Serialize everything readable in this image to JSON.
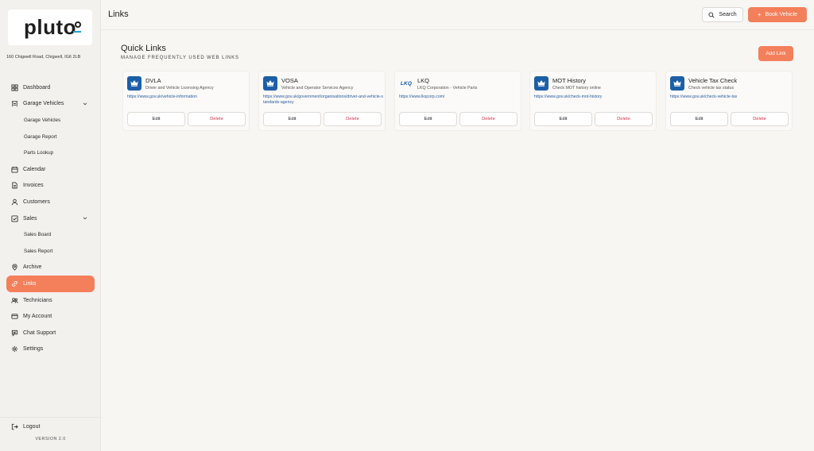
{
  "app": {
    "logo_text": "pluto",
    "address": "160 Chigwell Road, Chigwell, IG6 2LB",
    "version": "VERSION 2.0",
    "accent_color": "#f47f5b",
    "link_color": "#2b5b9e",
    "delete_color": "#d6334a"
  },
  "sidebar": {
    "items": [
      {
        "label": "Dashboard",
        "icon": "dashboard-icon"
      },
      {
        "label": "Garage Vehicles",
        "icon": "garage-icon",
        "expanded": true
      },
      {
        "label": "Garage Vehicles",
        "sub": true
      },
      {
        "label": "Garage Report",
        "sub": true
      },
      {
        "label": "Parts Lookup",
        "sub": true
      },
      {
        "label": "Calendar",
        "icon": "calendar-icon"
      },
      {
        "label": "Invoices",
        "icon": "invoice-icon"
      },
      {
        "label": "Customers",
        "icon": "user-icon"
      },
      {
        "label": "Sales",
        "icon": "sales-icon",
        "expanded": true
      },
      {
        "label": "Sales Board",
        "sub": true
      },
      {
        "label": "Sales Report",
        "sub": true
      },
      {
        "label": "Archive",
        "icon": "archive-icon"
      },
      {
        "label": "Links",
        "icon": "link-icon",
        "active": true
      },
      {
        "label": "Technicians",
        "icon": "technicians-icon"
      },
      {
        "label": "My Account",
        "icon": "account-icon"
      },
      {
        "label": "Chat Support",
        "icon": "chat-icon"
      },
      {
        "label": "Settings",
        "icon": "settings-icon"
      }
    ],
    "logout_label": "Logout"
  },
  "header": {
    "title": "Links",
    "search_label": "Search",
    "book_label": "Book Vehicle"
  },
  "main": {
    "title": "Quick Links",
    "subtitle": "MANAGE FREQUENTLY USED WEB LINKS",
    "add_label": "Add Link",
    "edit_label": "Edit",
    "delete_label": "Delete",
    "links": [
      {
        "name": "DVLA",
        "desc": "Driver and Vehicle Licensing Agency",
        "url": "https://www.gov.uk/vehicle-information",
        "icon": "crown-icon"
      },
      {
        "name": "VOSA",
        "desc": "Vehicle and Operator Services Agency",
        "url": "https://www.gov.uk/government/organisations/driver-and-vehicle-standards-agency",
        "icon": "crown-icon"
      },
      {
        "name": "LKQ",
        "desc": "LKQ Corporation - Vehicle Parts",
        "url": "https://www.lkqcorp.com/",
        "icon": "lkq-logo",
        "logo_text": "LKQ"
      },
      {
        "name": "MOT History",
        "desc": "Check MOT history online",
        "url": "https://www.gov.uk/check-mot-history",
        "icon": "crown-icon"
      },
      {
        "name": "Vehicle Tax Check",
        "desc": "Check vehicle tax status",
        "url": "https://www.gov.uk/check-vehicle-tax",
        "icon": "crown-icon"
      }
    ]
  }
}
